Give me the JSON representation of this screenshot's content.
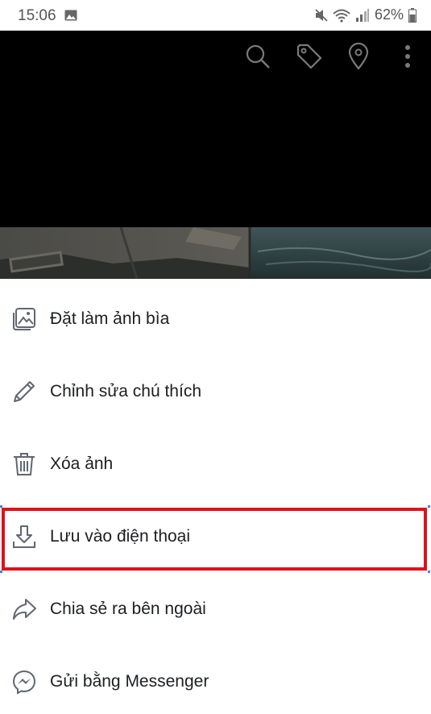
{
  "status_bar": {
    "time": "15:06",
    "battery": "62%"
  },
  "photo_toolbar": {
    "icons": [
      "search-icon",
      "tag-icon",
      "location-icon",
      "more-vertical-icon"
    ]
  },
  "menu": {
    "items": [
      {
        "label": "Đặt làm ảnh bìa",
        "icon": "cover-photo-icon"
      },
      {
        "label": "Chỉnh sửa chú thích",
        "icon": "pencil-icon"
      },
      {
        "label": "Xóa ảnh",
        "icon": "trash-icon"
      },
      {
        "label": "Lưu vào điện thoại",
        "icon": "download-icon"
      },
      {
        "label": "Chia sẻ ra bên ngoài",
        "icon": "share-icon"
      },
      {
        "label": "Gửi bằng Messenger",
        "icon": "messenger-icon"
      }
    ],
    "highlighted_index": 3
  },
  "colors": {
    "highlight": "#e0111b",
    "text": "#1c1e21",
    "icon": "#606770"
  }
}
